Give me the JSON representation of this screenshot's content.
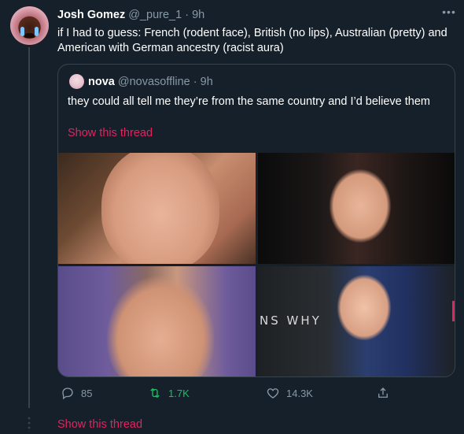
{
  "tweet": {
    "name": "Josh Gomez",
    "handle": "@_pure_1",
    "separator": "·",
    "time": "9h",
    "text": "if I had to guess: French (rodent face), British (no lips), Australian (pretty) and American with German ancestry (racist aura)",
    "more_icon": "more-horizontal-icon"
  },
  "quote": {
    "name": "nova",
    "handle": "@novasoffline",
    "separator": "·",
    "time": "9h",
    "text": "they could all tell me they’re from the same country and I’d believe them",
    "show_thread": "Show this thread",
    "photo_sign_text": "NS WHY"
  },
  "actions": {
    "reply_count": "85",
    "retweet_count": "1.7K",
    "like_count": "14.3K"
  },
  "show_thread": "Show this thread",
  "colors": {
    "background": "#15202b",
    "border": "#38444d",
    "secondary_text": "#8899a6",
    "link_pink": "#e0245e",
    "retweet_green": "#17bf63"
  }
}
